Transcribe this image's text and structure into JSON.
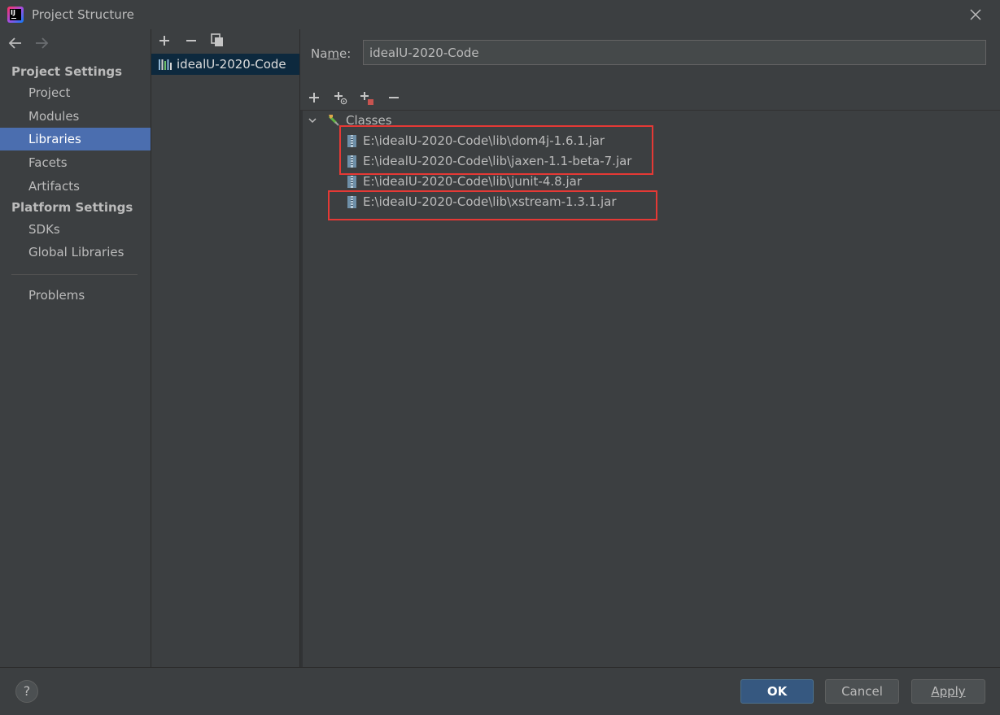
{
  "window": {
    "title": "Project Structure",
    "logo_text": "IJ"
  },
  "sidebar": {
    "project_settings_header": "Project Settings",
    "project_items": [
      {
        "label": "Project"
      },
      {
        "label": "Modules"
      },
      {
        "label": "Libraries",
        "selected": true
      },
      {
        "label": "Facets"
      },
      {
        "label": "Artifacts"
      }
    ],
    "platform_settings_header": "Platform Settings",
    "platform_items": [
      {
        "label": "SDKs"
      },
      {
        "label": "Global Libraries"
      }
    ],
    "problems_label": "Problems"
  },
  "library_panel": {
    "libraries": [
      {
        "label": "idealU-2020-Code",
        "selected": true
      }
    ]
  },
  "detail": {
    "name_label_prefix": "Na",
    "name_label_mnemonic": "m",
    "name_label_suffix": "e:",
    "name_value": "idealU-2020-Code",
    "classes_node": "Classes",
    "jars": [
      "E:\\idealU-2020-Code\\lib\\dom4j-1.6.1.jar",
      "E:\\idealU-2020-Code\\lib\\jaxen-1.1-beta-7.jar",
      "E:\\idealU-2020-Code\\lib\\junit-4.8.jar",
      "E:\\idealU-2020-Code\\lib\\xstream-1.3.1.jar"
    ]
  },
  "footer": {
    "help_label": "?",
    "ok_label": "OK",
    "cancel_label": "Cancel",
    "apply_label": "Apply"
  },
  "colors": {
    "background": "#3c3f41",
    "selection": "#4b6eaf",
    "library_selection": "#0d293e",
    "primary_button": "#365880",
    "highlight_box": "#e53935"
  }
}
